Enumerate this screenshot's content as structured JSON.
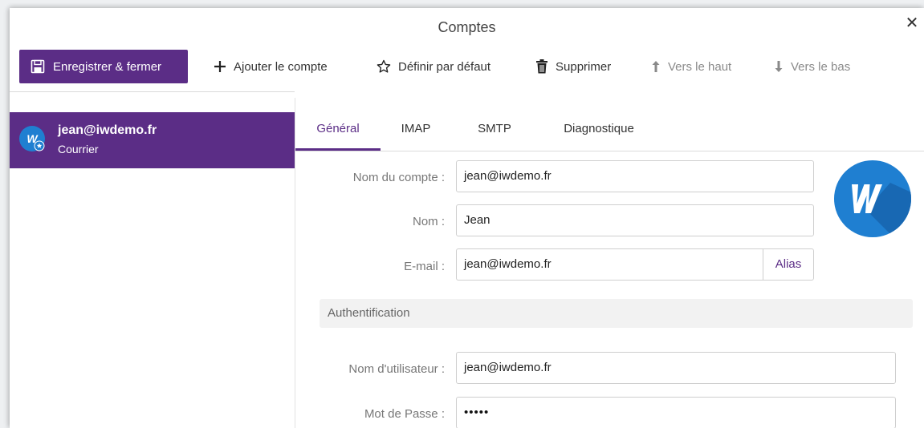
{
  "window": {
    "title": "Comptes"
  },
  "toolbar": {
    "save_close": "Enregistrer & fermer",
    "add_account": "Ajouter le compte",
    "set_default": "Définir par défaut",
    "delete": "Supprimer",
    "move_up": "Vers le haut",
    "move_down": "Vers le bas"
  },
  "sidebar": {
    "accounts": [
      {
        "name": "jean@iwdemo.fr",
        "type": "Courrier",
        "selected": true
      }
    ]
  },
  "tabs": [
    {
      "label": "Général",
      "active": true
    },
    {
      "label": "IMAP",
      "active": false
    },
    {
      "label": "SMTP",
      "active": false
    },
    {
      "label": "Diagnostique",
      "active": false
    }
  ],
  "form": {
    "account_name_label": "Nom du compte :",
    "account_name_value": "jean@iwdemo.fr",
    "name_label": "Nom :",
    "name_value": "Jean",
    "email_label": "E-mail :",
    "email_value": "jean@iwdemo.fr",
    "alias_button": "Alias",
    "auth_section": "Authentification",
    "username_label": "Nom d'utilisateur :",
    "username_value": "jean@iwdemo.fr",
    "password_label": "Mot de Passe :",
    "password_value": "•••••"
  },
  "colors": {
    "accent": "#5b2d86",
    "avatar": "#1f7fd1"
  },
  "icons": {
    "save": "save-icon",
    "add": "plus-icon",
    "default": "star-icon",
    "delete": "trash-icon",
    "up": "arrow-up-icon",
    "down": "arrow-down-icon",
    "close": "close-icon"
  }
}
